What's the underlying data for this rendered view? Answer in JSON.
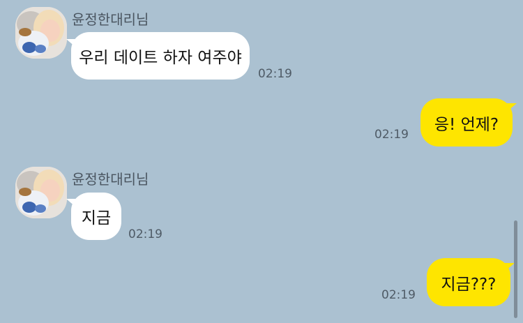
{
  "colors": {
    "background": "#abc1d1",
    "incoming_bubble": "#ffffff",
    "outgoing_bubble": "#fee500"
  },
  "messages": [
    {
      "direction": "incoming",
      "sender": "윤정한대리님",
      "text": "우리 데이트 하자 여주야",
      "time": "02:19"
    },
    {
      "direction": "outgoing",
      "text": "응! 언제?",
      "time": "02:19"
    },
    {
      "direction": "incoming",
      "sender": "윤정한대리님",
      "text": "지금",
      "time": "02:19"
    },
    {
      "direction": "outgoing",
      "text": "지금???",
      "time": "02:19"
    }
  ]
}
